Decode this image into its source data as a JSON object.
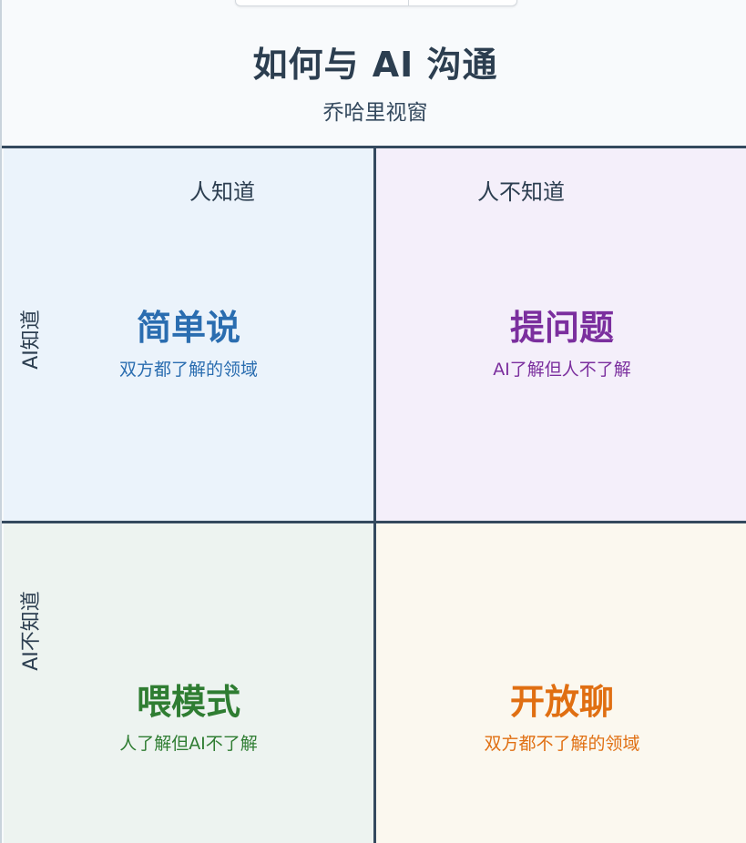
{
  "header": {
    "title": "如何与 AI 沟通",
    "subtitle": "乔哈里视窗"
  },
  "axes": {
    "col_known": "人知道",
    "col_unknown": "人不知道",
    "row_known": "AI知道",
    "row_unknown": "AI不知道"
  },
  "quadrants": {
    "top_left": {
      "title": "简单说",
      "desc": "双方都了解的领域",
      "color": "#2a6db0"
    },
    "top_right": {
      "title": "提问题",
      "desc": "AI了解但人不了解",
      "color": "#7b2f9e"
    },
    "bottom_left": {
      "title": "喂模式",
      "desc": "人了解但AI不了解",
      "color": "#2f7d32"
    },
    "bottom_right": {
      "title": "开放聊",
      "desc": "双方都不了解的领域",
      "color": "#e06f12"
    }
  },
  "colors": {
    "line": "#34495e",
    "text_dark": "#2c3e50"
  }
}
